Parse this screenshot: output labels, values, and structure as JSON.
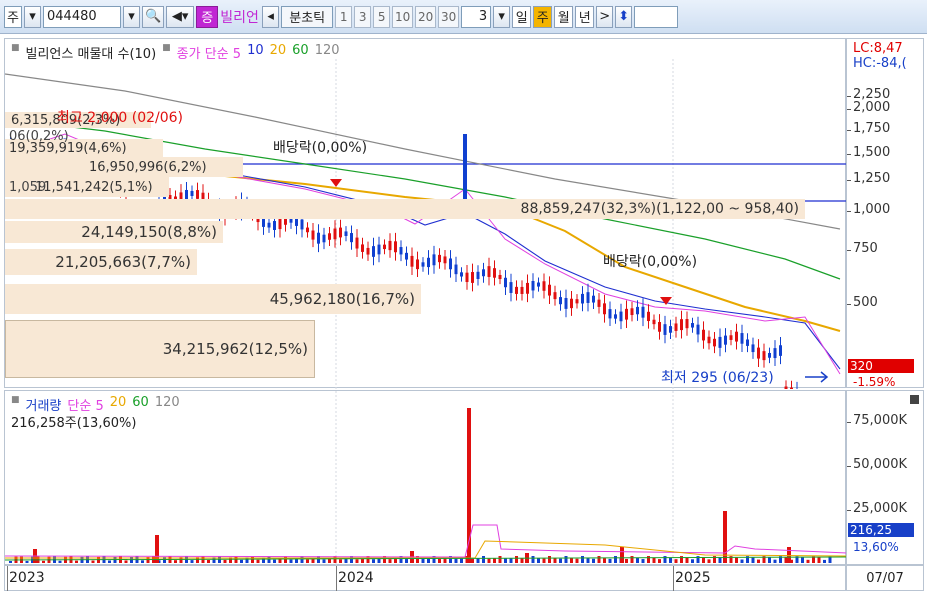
{
  "toolbar": {
    "market": "주",
    "code": "044480",
    "jeung": "증",
    "stock_name": "빌리언",
    "divider": "분초틱",
    "nums": [
      "1",
      "3",
      "5",
      "10",
      "20",
      "30"
    ],
    "count": "3",
    "periods": [
      "일",
      "주",
      "월",
      "년"
    ],
    "active_period": "주",
    "next": ">"
  },
  "price_panel": {
    "legend_title": "빌리언스 매물대 수(10)",
    "legend_ma_label": "종가 단순 5",
    "legend_ma": [
      "10",
      "20",
      "60",
      "120"
    ],
    "lc": "LC:8,47",
    "hc": "HC:-84,(",
    "ticks": [
      "2,250",
      "2,000",
      "1,750",
      "1,500",
      "1,250",
      "1,000",
      "750",
      "500"
    ],
    "price_tag": "320",
    "pct_tag": "-1.59%",
    "high_label": "최고 2,000 (02/06)",
    "low_label": "최저 295 (06/23)",
    "div1": "배당락(0,00%)",
    "div2": "배당락(0,00%)",
    "volume_profile": [
      {
        "label": "6,315,809(2,3%)"
      },
      {
        "label": "19,359,919(4,6%)"
      },
      {
        "label": "16,950,996(6,2%)"
      },
      {
        "label": "11,541,242(5,1%)"
      },
      {
        "label": "88,859,247(32,3%)(1,122,00 ~ 958,40)"
      },
      {
        "label": "24,149,150(8,8%)"
      },
      {
        "label": "21,205,663(7,7%)"
      },
      {
        "label": "45,962,180(16,7%)"
      },
      {
        "label": "34,215,962(12,5%)"
      }
    ],
    "overlap_texts": [
      "06(0,2%)",
      "1,059"
    ],
    "colors": {
      "ma5": "#e040e0",
      "ma10": "#1f2fd0",
      "ma20": "#e8a800",
      "ma60": "#1aa02a",
      "ma120": "#888888",
      "up": "#e01010",
      "down": "#1040d0"
    }
  },
  "volume_panel": {
    "legend_title": "거래량",
    "legend_ma_label": "단순 5",
    "legend_ma": [
      "20",
      "60",
      "120"
    ],
    "current": "216,258주(13,60%)",
    "ticks": [
      "75,000K",
      "50,000K",
      "25,000K"
    ],
    "tag_value": "216,25",
    "tag_pct": "13,60%"
  },
  "xaxis": {
    "labels": [
      "2023",
      "2024",
      "2025"
    ],
    "date": "07/07"
  }
}
